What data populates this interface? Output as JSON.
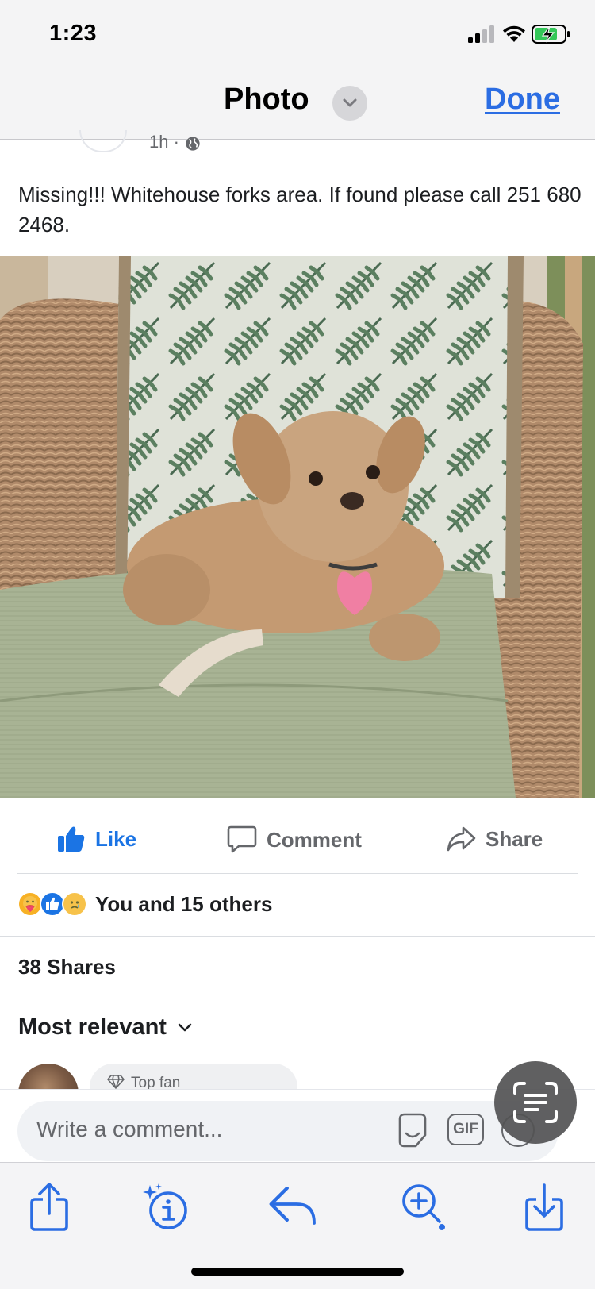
{
  "status_bar": {
    "time": "1:23"
  },
  "header": {
    "title": "Photo",
    "done_label": "Done"
  },
  "post": {
    "meta_partial": "1h ·",
    "caption": "Missing!!! Whitehouse forks area. If found please call 251 680 2468."
  },
  "actions": {
    "like_label": "Like",
    "comment_label": "Comment",
    "share_label": "Share"
  },
  "reactions": {
    "icons": [
      "care-icon",
      "like-reaction-icon",
      "sad-icon"
    ],
    "summary": "You and 15 others"
  },
  "shares": "38 Shares",
  "sort": {
    "label": "Most relevant"
  },
  "comments": [
    {
      "badge": "Top fan"
    }
  ],
  "composer": {
    "placeholder": "Write a comment...",
    "gif_label": "GIF"
  },
  "colors": {
    "accent": "#2b6de3",
    "like_blue": "#1b74e4",
    "muted": "#65676b"
  }
}
